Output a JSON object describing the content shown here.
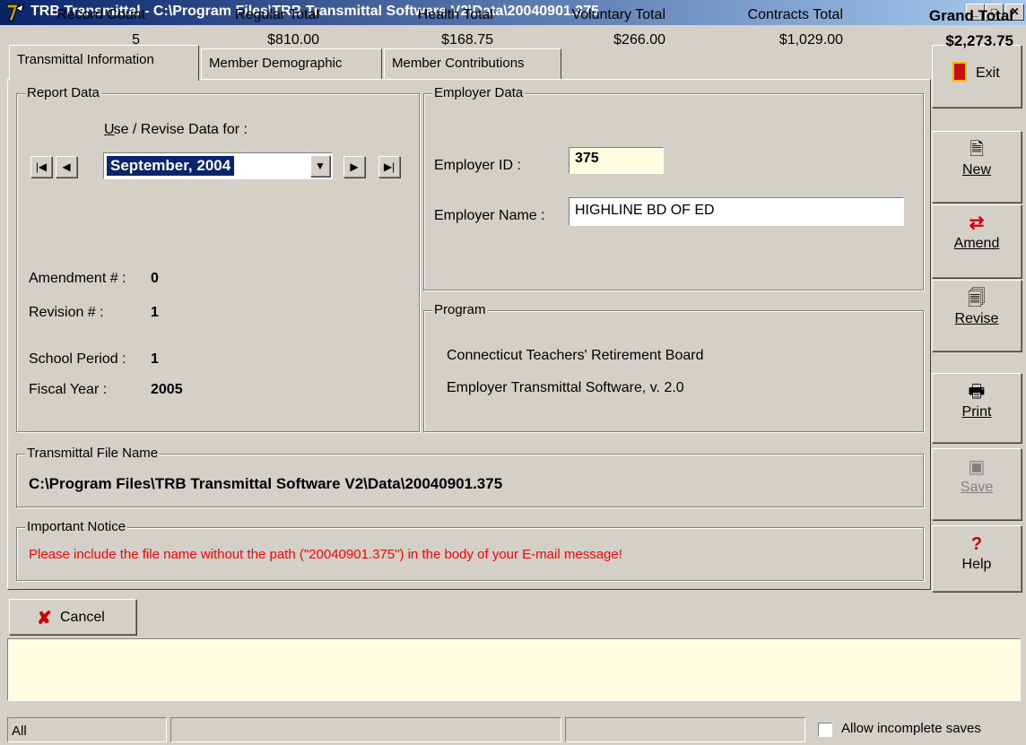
{
  "window": {
    "title": "TRB Transmittal - C:\\Program Files\\TRB Transmittal Software V2\\Data\\20040901.375",
    "minimize_icon": "minimize-icon",
    "maximize_icon": "maximize-icon",
    "close_icon": "close-icon"
  },
  "tabs": [
    {
      "label": "Transmittal Information",
      "active": true
    },
    {
      "label": "Member Demographic",
      "active": false
    },
    {
      "label": "Member Contributions",
      "active": false
    }
  ],
  "report_data": {
    "group_title": "Report Data",
    "use_revise_label": "Use / Revise Data for :",
    "period_selected": "September, 2004",
    "amendment_label": "Amendment # :",
    "amendment_value": "0",
    "revision_label": "Revision # :",
    "revision_value": "1",
    "school_period_label": "School Period :",
    "school_period_value": "1",
    "fiscal_year_label": "Fiscal Year :",
    "fiscal_year_value": "2005"
  },
  "employer_data": {
    "group_title": "Employer Data",
    "id_label": "Employer ID :",
    "id_value": "375",
    "name_label": "Employer Name :",
    "name_value": "HIGHLINE BD OF ED"
  },
  "program": {
    "group_title": "Program",
    "line1": "Connecticut Teachers' Retirement Board",
    "line2": "Employer Transmittal Software, v. 2.0"
  },
  "file_name": {
    "group_title": "Transmittal File Name",
    "value": "C:\\Program Files\\TRB Transmittal Software V2\\Data\\20040901.375"
  },
  "notice": {
    "group_title": "Important Notice",
    "text": "Please include the file name without the path (\"20040901.375\") in the body of your E-mail message!",
    "color": "#ff0000"
  },
  "side_buttons": {
    "exit": "Exit",
    "new": "New",
    "amend": "Amend",
    "revise": "Revise",
    "print": "Print",
    "save": "Save",
    "help": "Help"
  },
  "cancel_label": "Cancel",
  "totals": {
    "record_count_label": "Record Count",
    "record_count": "5",
    "regular_label": "Regular Total",
    "regular": "$810.00",
    "health_label": "Health Total",
    "health": "$168.75",
    "voluntary_label": "Voluntary Total",
    "voluntary": "$266.00",
    "contracts_label": "Contracts Total",
    "contracts": "$1,029.00",
    "grand_label": "Grand Total",
    "grand": "$2,273.75"
  },
  "status_bar": {
    "filter": "All",
    "allow_incomplete_label": "Allow incomplete saves",
    "allow_incomplete_checked": false
  }
}
